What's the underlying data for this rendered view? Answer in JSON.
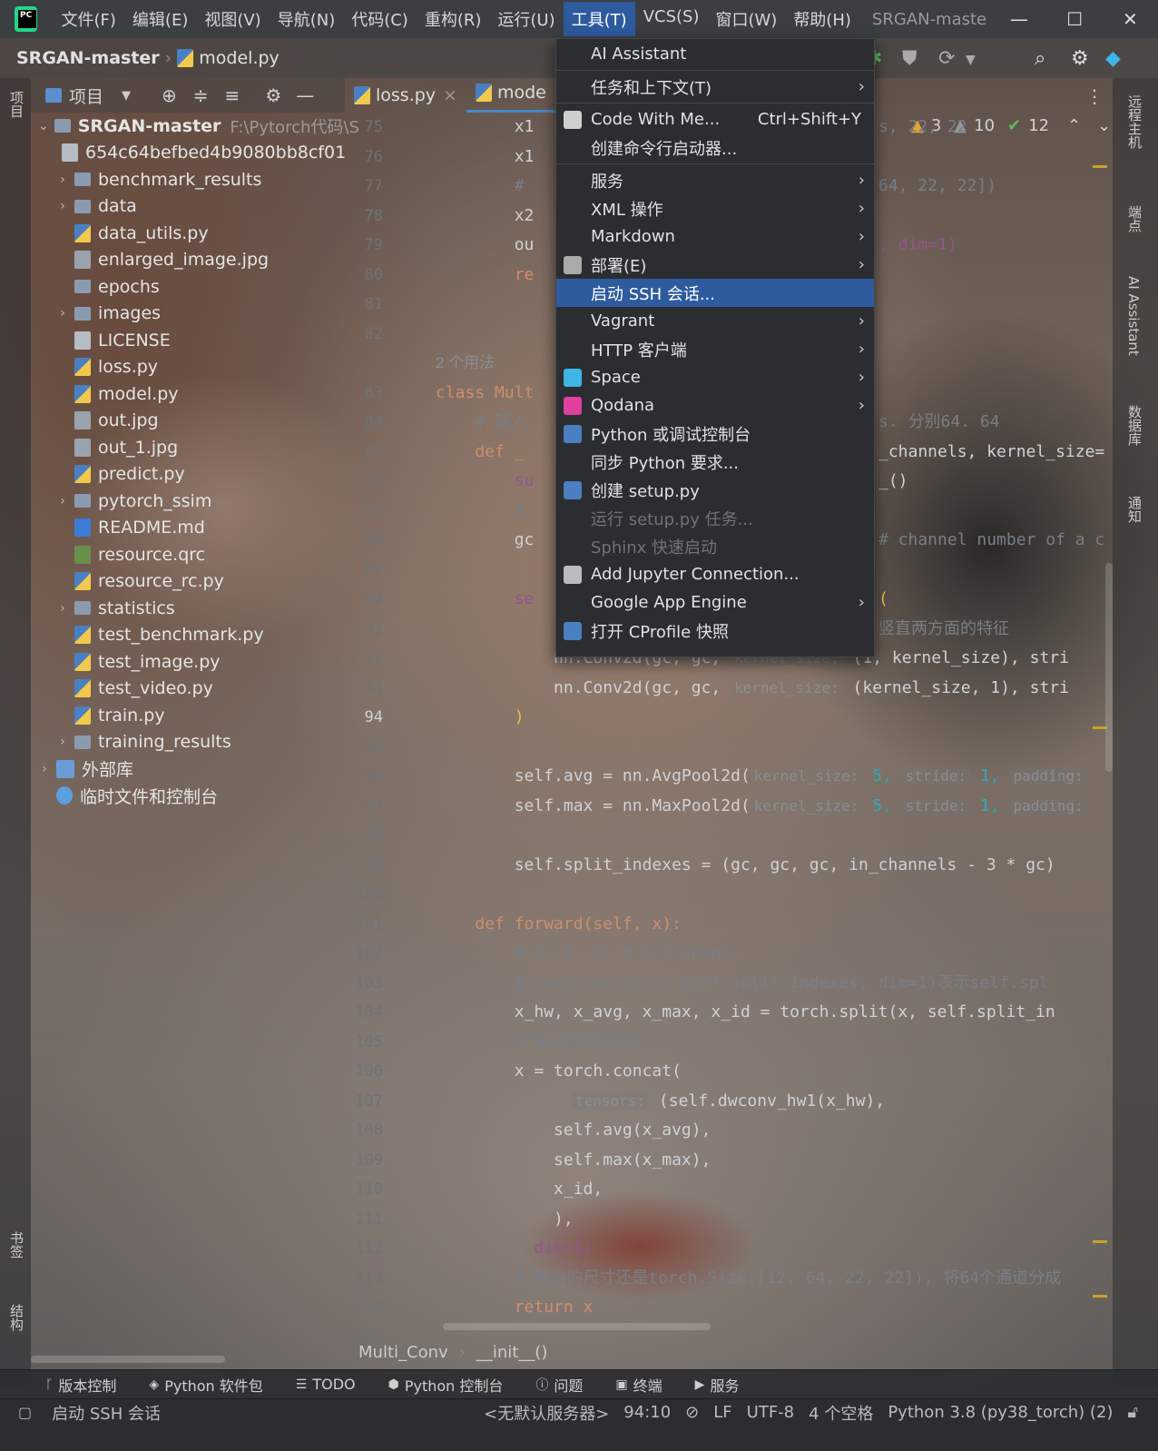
{
  "titlebar": {
    "menus": [
      "文件(F)",
      "编辑(E)",
      "视图(V)",
      "导航(N)",
      "代码(C)",
      "重构(R)",
      "运行(U)",
      "工具(T)",
      "VCS(S)",
      "窗口(W)",
      "帮助(H)"
    ],
    "title": "SRGAN-maste",
    "minimize": "—",
    "maximize": "☐",
    "close": "✕"
  },
  "navbar": {
    "project": "SRGAN-master",
    "file": "model.py"
  },
  "project_panel": {
    "title": "项目",
    "root": "SRGAN-master",
    "root_path": "F:\\Pytorch代码\\S",
    "items": [
      {
        "label": "654c64befbed4b9080bb8cf01",
        "type": "doc",
        "arrow": ""
      },
      {
        "label": "benchmark_results",
        "type": "fold",
        "arrow": "›"
      },
      {
        "label": "data",
        "type": "fold",
        "arrow": "›"
      },
      {
        "label": "data_utils.py",
        "type": "py",
        "arrow": ""
      },
      {
        "label": "enlarged_image.jpg",
        "type": "img",
        "arrow": ""
      },
      {
        "label": "epochs",
        "type": "fold",
        "arrow": ""
      },
      {
        "label": "images",
        "type": "fold",
        "arrow": "›"
      },
      {
        "label": "LICENSE",
        "type": "doc",
        "arrow": ""
      },
      {
        "label": "loss.py",
        "type": "py",
        "arrow": ""
      },
      {
        "label": "model.py",
        "type": "py",
        "arrow": ""
      },
      {
        "label": "out.jpg",
        "type": "img",
        "arrow": ""
      },
      {
        "label": "out_1.jpg",
        "type": "img",
        "arrow": ""
      },
      {
        "label": "predict.py",
        "type": "py",
        "arrow": ""
      },
      {
        "label": "pytorch_ssim",
        "type": "fold",
        "arrow": "›"
      },
      {
        "label": "README.md",
        "type": "md",
        "arrow": ""
      },
      {
        "label": "resource.qrc",
        "type": "qrc",
        "arrow": ""
      },
      {
        "label": "resource_rc.py",
        "type": "py",
        "arrow": ""
      },
      {
        "label": "statistics",
        "type": "fold",
        "arrow": "›"
      },
      {
        "label": "test_benchmark.py",
        "type": "py",
        "arrow": ""
      },
      {
        "label": "test_image.py",
        "type": "py",
        "arrow": ""
      },
      {
        "label": "test_video.py",
        "type": "py",
        "arrow": ""
      },
      {
        "label": "train.py",
        "type": "py",
        "arrow": ""
      },
      {
        "label": "training_results",
        "type": "fold",
        "arrow": "›"
      }
    ],
    "external": "外部库",
    "scratch": "临时文件和控制台"
  },
  "tabs": [
    {
      "label": "loss.py",
      "close": "×"
    },
    {
      "label": "mode"
    }
  ],
  "inspections": {
    "warn": "3",
    "weak": "10",
    "ok": "12"
  },
  "editor": {
    "line_numbers": [
      "75",
      "76",
      "77",
      "78",
      "79",
      "80",
      "81",
      "82",
      "",
      "83",
      "84",
      "85",
      "86",
      "87",
      "88",
      "89",
      "90",
      "91",
      "92",
      "93",
      "94",
      "95",
      "96",
      "97",
      "98",
      "99",
      "100",
      "101",
      "102",
      "103",
      "104",
      "105",
      "106",
      "107",
      "108",
      "109",
      "110",
      "111",
      "112",
      "113",
      "114",
      "115"
    ],
    "usage": "2 个用法",
    "lines": {
      "l0": "        x1",
      "l0r": "s, 22, 22",
      "l1": "        x1",
      "l2": "        #",
      "l2r": "64, 22, 22])",
      "l3": "        x2",
      "l4": "        ou",
      "l4r": ", dim=1)",
      "l5": "        re",
      "cls": "class Mult",
      "l7": "    # 输入",
      "l7r": "s. 分别64. 64",
      "l8": "    def _",
      "l8r": "_channels, kernel_size=",
      "l9": "        su",
      "l9r": "_()",
      "l10": "        #",
      "l11": "        gc",
      "l11r": "# channel number of a co",
      "l12": "        se",
      "l12r": "(",
      "l13r": "竖直两方面的特征",
      "l14a": "            nn.Conv2d(gc, gc, ",
      "l14h": "kernel_size:",
      "l14b": " (1, kernel_size), stri",
      "l15a": "            nn.Conv2d(gc, gc, ",
      "l15h": "kernel_size:",
      "l15b": " (kernel_size, 1), stri",
      "l16": "        )",
      "l18a": "        self.avg = nn.AvgPool2d(",
      "l18h1": "kernel_size:",
      "l18b": " 5, ",
      "l18h2": "stride:",
      "l18c": " 1, ",
      "l18h3": "padding:",
      "l19a": "        self.max = nn.MaxPool2d(",
      "l19h1": "kernel_size:",
      "l19b": " 5, ",
      "l19h2": "stride:",
      "l19c": " 1, ",
      "l19h3": "padding:",
      "l21": "        self.split_indexes = (gc, gc, gc, in_channels - 3 * gc)",
      "l23": "    def forward(self, x):",
      "l24": "        # B, C, H, W = x.shape",
      "l25": "        # torch.split(x, self.split_indexes, dim=1)表示self.spl",
      "l26": "        x_hw, x_avg, x_max, x_id = torch.split(x, self.split_in",
      "l27": "        # 每一部分都是1/4",
      "l28": "        x = torch.concat(",
      "l29h": "tensors:",
      "l29": " (self.dwconv_hw1(x_hw),",
      "l30": "            self.avg(x_avg),",
      "l31": "            self.max(x_max),",
      "l32": "            x_id,",
      "l33": "            ),",
      "l34": "          dim=1)",
      "l35": "        # 输出的尺寸还是torch.Size([12, 64, 22, 22]), 将64个通道分成",
      "l36": "        return x"
    }
  },
  "breadcrumb": {
    "cls": "Multi_Conv",
    "method": "__init__()"
  },
  "tool_windows": [
    "版本控制",
    "Python 软件包",
    "TODO",
    "Python 控制台",
    "问题",
    "终端",
    "服务"
  ],
  "status": {
    "msg": "启动 SSH 会话",
    "server": "<无默认服务器>",
    "pos": "94:10",
    "le": "LF",
    "enc": "UTF-8",
    "indent": "4 个空格",
    "interp": "Python 3.8 (py38_torch) (2)"
  },
  "left_strip": {
    "project": "项目",
    "bookmarks": "书签",
    "structure": "结构"
  },
  "right_strip": {
    "remote": "远程主机",
    "endpoints": "端点",
    "ai": "AI Assistant",
    "db": "数据库",
    "notify": "通知"
  },
  "tools_menu": [
    {
      "label": "AI Assistant",
      "sub": "",
      "icon": ""
    },
    {
      "sep": true
    },
    {
      "label": "任务和上下文(T)",
      "sub": "›",
      "icon": ""
    },
    {
      "sep": true
    },
    {
      "label": "Code With Me...",
      "shortcut": "Ctrl+Shift+Y",
      "icon": "#cfcfcf"
    },
    {
      "label": "创建命令行启动器...",
      "icon": ""
    },
    {
      "sep": true
    },
    {
      "label": "服务",
      "sub": "›"
    },
    {
      "label": "XML 操作",
      "sub": "›"
    },
    {
      "label": "Markdown",
      "sub": "›"
    },
    {
      "label": "部署(E)",
      "sub": "›",
      "icon": "#aaaaaa"
    },
    {
      "label": "启动 SSH 会话...",
      "hl": true
    },
    {
      "label": "Vagrant",
      "sub": "›"
    },
    {
      "label": "HTTP 客户端",
      "sub": "›"
    },
    {
      "label": "Space",
      "sub": "›",
      "icon": "#3fb4e6"
    },
    {
      "label": "Qodana",
      "sub": "›",
      "icon": "#e040a0"
    },
    {
      "label": "Python 或调试控制台",
      "icon": "#4a7fc1"
    },
    {
      "label": "同步 Python 要求..."
    },
    {
      "label": "创建 setup.py",
      "icon": "#4a7fc1"
    },
    {
      "label": "运行 setup.py 任务...",
      "dis": true
    },
    {
      "label": "Sphinx 快速启动",
      "dis": true
    },
    {
      "label": "Add Jupyter Connection...",
      "icon": "#bbbbbb"
    },
    {
      "label": "Google App Engine",
      "sub": "›"
    },
    {
      "label": "打开 CProfile 快照",
      "icon": "#4a7fc1"
    }
  ],
  "colors": {
    "accent": "#2e5b9e",
    "keyword": "#cf8e6d",
    "self": "#94558d",
    "number": "#2aacb8",
    "comment": "#7a7e85"
  }
}
